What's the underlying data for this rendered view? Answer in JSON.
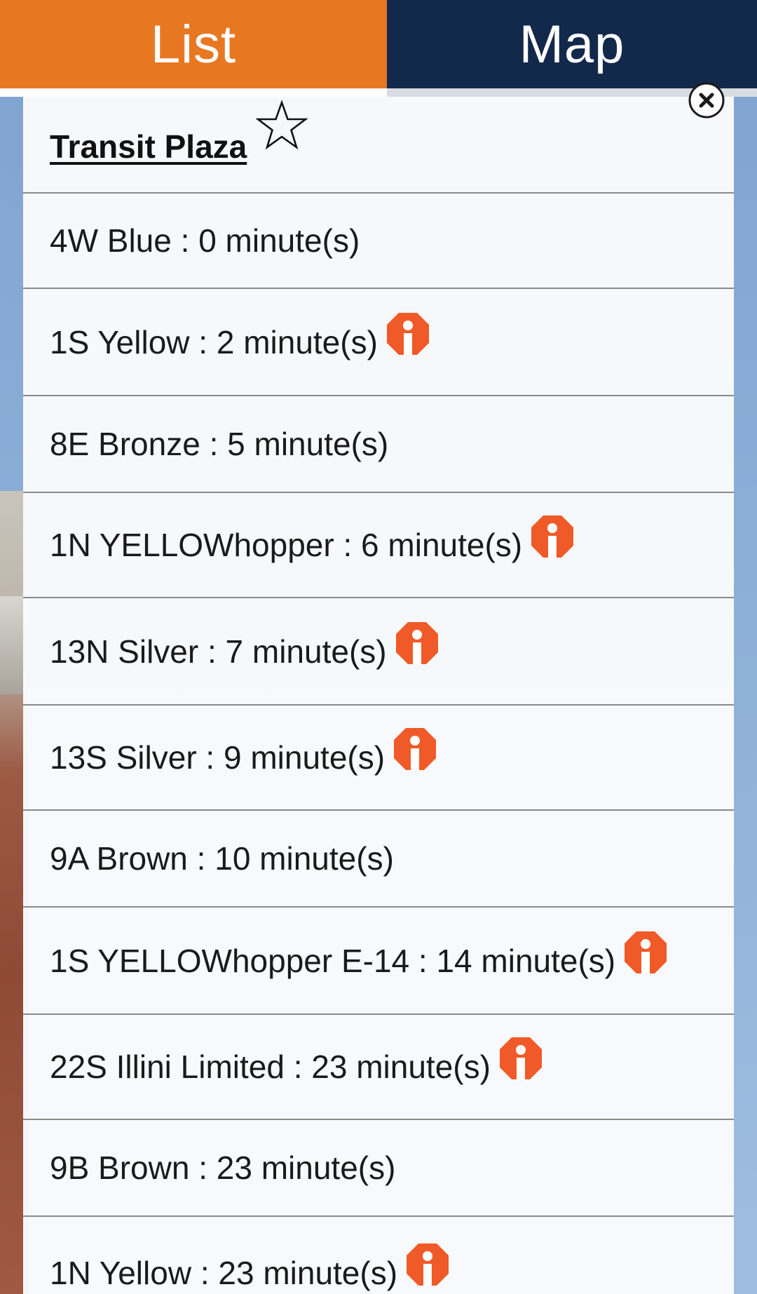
{
  "tabs": {
    "list_label": "List",
    "map_label": "Map",
    "active": "List"
  },
  "stop": {
    "name": "Transit Plaza",
    "favorite_icon": "star-outline-icon",
    "close_icon": "close-circle-icon"
  },
  "departures": [
    {
      "text": "4W Blue : 0 minute(s)",
      "has_info": false
    },
    {
      "text": "1S Yellow : 2 minute(s)",
      "has_info": true
    },
    {
      "text": "8E Bronze : 5 minute(s)",
      "has_info": false
    },
    {
      "text": "1N YELLOWhopper : 6 minute(s)",
      "has_info": true
    },
    {
      "text": "13N Silver : 7 minute(s)",
      "has_info": true
    },
    {
      "text": "13S Silver : 9 minute(s)",
      "has_info": true
    },
    {
      "text": "9A Brown : 10 minute(s)",
      "has_info": false
    },
    {
      "text": "1S YELLOWhopper E-14 : 14 minute(s)",
      "has_info": true
    },
    {
      "text": "22S Illini Limited : 23 minute(s)",
      "has_info": true
    },
    {
      "text": "9B Brown : 23 minute(s)",
      "has_info": false
    },
    {
      "text": "1N Yellow : 23 minute(s)",
      "has_info": true
    }
  ],
  "colors": {
    "list_tab": "#e87722",
    "map_tab": "#13294b",
    "info_icon": "#f05a28"
  }
}
